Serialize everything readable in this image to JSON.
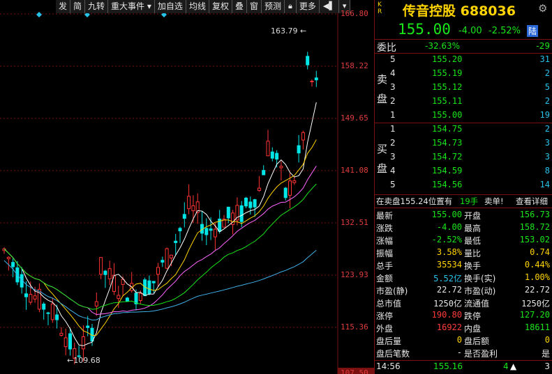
{
  "toolbar": {
    "items": [
      "发",
      "简",
      "九转",
      "重大事件",
      "加自选",
      "均线",
      "复权",
      "叠",
      "窗",
      "预测",
      "更多"
    ]
  },
  "chart": {
    "price_labels": [
      "166.80",
      "158.22",
      "149.65",
      "141.08",
      "132.51",
      "123.93",
      "115.36",
      "107.50"
    ],
    "high_marker": "163.79",
    "low_marker": "109.68",
    "colors": {
      "up": "#ff3232",
      "down": "#00e5e5",
      "ma5": "#ffffff",
      "ma10": "#ffd400",
      "ma20": "#ff66ff",
      "ma30": "#19e619",
      "ma60": "#3fb0e8"
    }
  },
  "quote": {
    "kr_top": "K",
    "kr_bottom": "R",
    "name": "传音控股",
    "code": "688036",
    "price": "155.00",
    "change": "-4.00",
    "change_pct": "-2.52%",
    "exchange_badge": "陆",
    "weibi_label": "委比",
    "weibi_pct": "-32.63%",
    "weibi_diff": "-29"
  },
  "sell_side": {
    "label_top": "卖",
    "label_bottom": "盘",
    "levels": [
      {
        "level": "5",
        "price": "155.20",
        "vol": "31"
      },
      {
        "level": "4",
        "price": "155.19",
        "vol": "2"
      },
      {
        "level": "3",
        "price": "155.12",
        "vol": "5"
      },
      {
        "level": "2",
        "price": "155.11",
        "vol": "2"
      },
      {
        "level": "1",
        "price": "155.00",
        "vol": "19"
      }
    ]
  },
  "buy_side": {
    "label_top": "买",
    "label_bottom": "盘",
    "levels": [
      {
        "level": "1",
        "price": "154.75",
        "vol": "2"
      },
      {
        "level": "2",
        "price": "154.73",
        "vol": "3"
      },
      {
        "level": "3",
        "price": "154.72",
        "vol": "3"
      },
      {
        "level": "4",
        "price": "154.59",
        "vol": "8"
      },
      {
        "level": "5",
        "price": "154.56",
        "vol": "14"
      }
    ]
  },
  "order_info": {
    "text": "在卖盘155.24位置有",
    "hands": "19手",
    "action": "卖单!",
    "detail": "查看详细"
  },
  "stats": [
    {
      "l1": "最新",
      "v1": "155.00",
      "c1": "green",
      "l2": "开盘",
      "v2": "156.73",
      "c2": "green"
    },
    {
      "l1": "涨跌",
      "v1": "-4.00",
      "c1": "green",
      "l2": "最高",
      "v2": "158.72",
      "c2": "green"
    },
    {
      "l1": "涨幅",
      "v1": "-2.52%",
      "c1": "green",
      "l2": "最低",
      "v2": "153.02",
      "c2": "green"
    },
    {
      "l1": "振幅",
      "v1": "3.58%",
      "c1": "yellow",
      "l2": "量比",
      "v2": "0.74",
      "c2": "yellow"
    },
    {
      "l1": "总手",
      "v1": "35534",
      "c1": "yellow",
      "l2": "换手",
      "v2": "0.44%",
      "c2": "yellow"
    },
    {
      "l1": "金额",
      "v1": "5.52亿",
      "c1": "cyan",
      "l2": "换手(实)",
      "v2": "1.00%",
      "c2": "yellow"
    },
    {
      "l1": "市盈(静)",
      "v1": "22.72",
      "c1": "white",
      "l2": "市盈(动)",
      "v2": "22.72",
      "c2": "white"
    },
    {
      "l1": "总市值",
      "v1": "1250亿",
      "c1": "white",
      "l2": "流通值",
      "v2": "1250亿",
      "c2": "white"
    },
    {
      "l1": "涨停",
      "v1": "190.80",
      "c1": "red",
      "l2": "跌停",
      "v2": "127.20",
      "c2": "green"
    },
    {
      "l1": "外盘",
      "v1": "16922",
      "c1": "red",
      "l2": "内盘",
      "v2": "18611",
      "c2": "green"
    },
    {
      "l1": "盘后量",
      "v1": "0",
      "c1": "yellow",
      "l2": "盘后额",
      "v2": "0",
      "c2": "yellow"
    },
    {
      "l1": "盘后笔数",
      "v1": "-",
      "c1": "white",
      "l2": "是否盈利",
      "v2": "是",
      "c2": "white"
    }
  ],
  "tick": {
    "time": "14:56",
    "price": "155.16",
    "vol": "4",
    "count": "3"
  }
}
